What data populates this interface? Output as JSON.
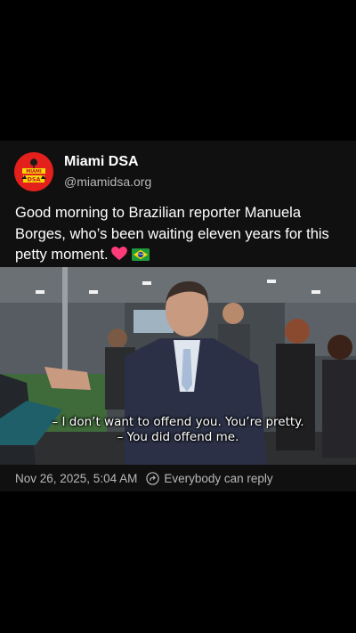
{
  "author": {
    "display_name": "Miami DSA",
    "handle": "@miamidsa.org",
    "avatar_text": "MIAMI DSA"
  },
  "post": {
    "text": "Good morning to Brazilian reporter Manuela Borges, who’s been waiting eleven years for this petty moment.",
    "emojis": [
      "heart",
      "flag-brazil"
    ]
  },
  "video": {
    "subtitles": [
      "– I don’t want to offend you. You’re pretty.",
      "– You did offend me."
    ]
  },
  "footer": {
    "timestamp": "Nov 26, 2025, 5:04 AM",
    "reply_setting": "Everybody can reply"
  },
  "colors": {
    "background": "#000000",
    "card": "#101010",
    "avatar": "#e3201b",
    "secondary_text": "#b8b8b8",
    "heart": "#ff3b7a"
  }
}
